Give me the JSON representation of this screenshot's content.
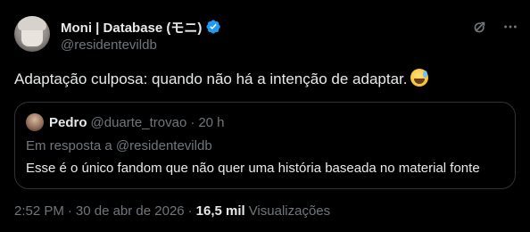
{
  "author": {
    "display_name": "Moni | Database (モニ)",
    "handle": "@residentevildb"
  },
  "icons": {
    "verified": "verified-badge-icon",
    "grok": "grok-icon",
    "more": "more-icon"
  },
  "colors": {
    "background": "#000000",
    "text": "#e7e9ea",
    "muted": "#71767b",
    "verified": "#1d9bf0",
    "border": "#2f3336"
  },
  "tweet": {
    "text": "Adaptação culposa: quando não há a intenção de adaptar.",
    "emoji": "grinning-face-with-sweat"
  },
  "quoted_tweet": {
    "display_name": "Pedro",
    "handle": "@duarte_trovao",
    "separator": "·",
    "time": "20 h",
    "reply_context": "Em resposta a @residentevildb",
    "text": "Esse é o único fandom que não quer uma história baseada no material fonte"
  },
  "meta": {
    "time": "2:52 PM",
    "separator": "·",
    "date": "30 de abr de 2026",
    "views_count": "16,5 mil",
    "views_label": "Visualizações"
  }
}
